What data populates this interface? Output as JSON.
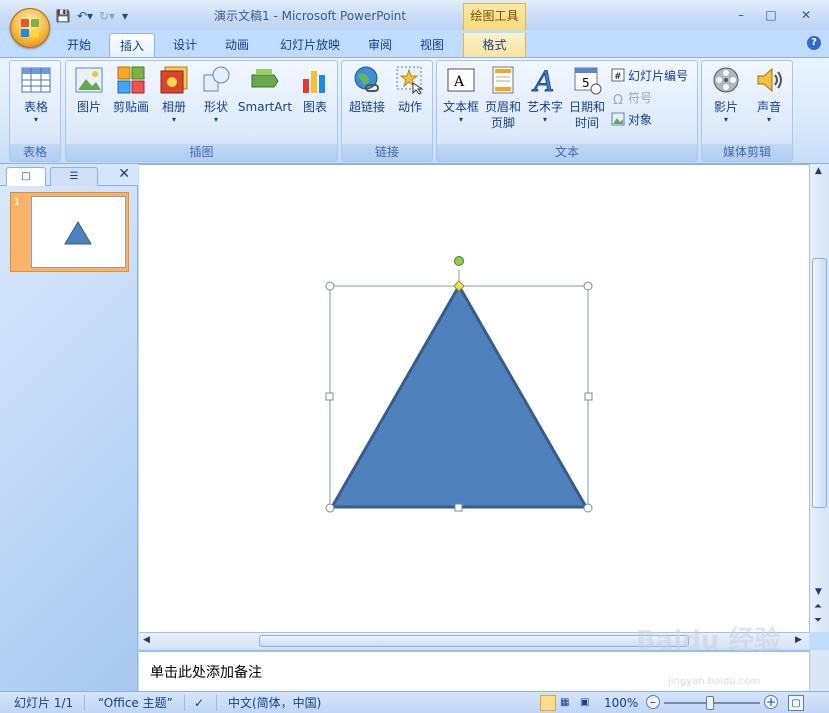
{
  "window": {
    "title": "演示文稿1 - Microsoft PowerPoint",
    "context_tab_title": "绘图工具",
    "controls": [
      "–",
      "□",
      "✕"
    ]
  },
  "tabs": [
    {
      "label": "开始",
      "active": false
    },
    {
      "label": "插入",
      "active": true
    },
    {
      "label": "设计",
      "active": false
    },
    {
      "label": "动画",
      "active": false
    },
    {
      "label": "幻灯片放映",
      "active": false
    },
    {
      "label": "审阅",
      "active": false
    },
    {
      "label": "视图",
      "active": false
    },
    {
      "label": "格式",
      "active": false
    }
  ],
  "ribbon": {
    "groups": {
      "table": "表格",
      "illustrations": "插图",
      "links": "链接",
      "text": "文本",
      "media": "媒体剪辑"
    },
    "buttons": {
      "table": "表格",
      "picture": "图片",
      "clipart": "剪贴画",
      "album": "相册",
      "shapes": "形状",
      "smartart": "SmartArt",
      "chart": "图表",
      "hyperlink": "超链接",
      "action": "动作",
      "textbox": "文本框",
      "header_footer_1": "页眉和",
      "header_footer_2": "页脚",
      "wordart": "艺术字",
      "datetime_1": "日期和",
      "datetime_2": "时间",
      "slide_number": "幻灯片编号",
      "symbol": "符号",
      "object": "对象",
      "movie": "影片",
      "sound": "声音"
    }
  },
  "slides_pane": {
    "slide_number": "1",
    "close_glyph": "✕"
  },
  "notes": {
    "placeholder": "单击此处添加备注"
  },
  "statusbar": {
    "slide_info": "幻灯片 1/1",
    "theme": "“Office 主题”",
    "language": "中文(简体，中国)",
    "zoom": "100%"
  },
  "watermark": {
    "text": "Baidu 经验",
    "sub": "jingyan.baidu.com"
  },
  "colors": {
    "triangle_fill": "#4f81bd",
    "triangle_stroke": "#385d8a",
    "handle_rotate": "#8ed04a",
    "handle_adjust": "#f7e35a"
  }
}
